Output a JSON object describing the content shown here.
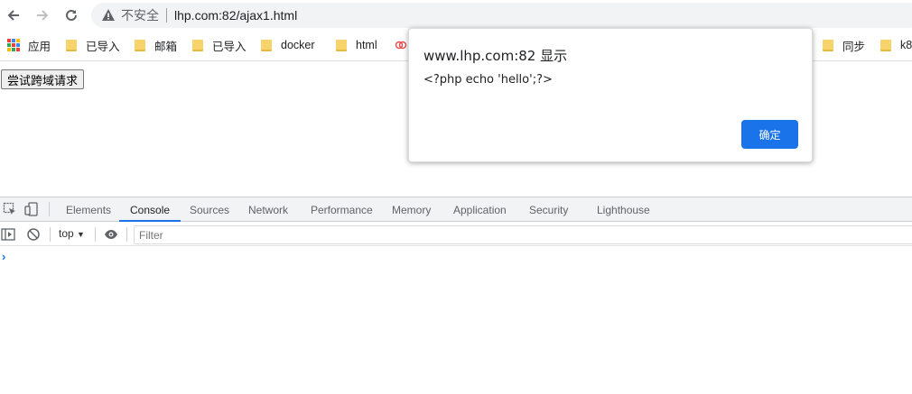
{
  "browser": {
    "insecure_label": "不安全",
    "url": "lhp.com:82/ajax1.html"
  },
  "bookmarks": [
    {
      "label": "应用",
      "icon": "apps-grid-icon"
    },
    {
      "label": "已导入",
      "icon": "folder-icon"
    },
    {
      "label": "邮箱",
      "icon": "folder-icon"
    },
    {
      "label": "已导入",
      "icon": "folder-icon"
    },
    {
      "label": "docker",
      "icon": "folder-icon"
    },
    {
      "label": "html",
      "icon": "folder-icon"
    },
    {
      "label": "同步",
      "icon": "folder-icon"
    },
    {
      "label": "k8",
      "icon": "folder-icon"
    }
  ],
  "page": {
    "button_label": "尝试跨域请求"
  },
  "dialog": {
    "title": "www.lhp.com:82 显示",
    "message": "<?php echo 'hello';?>",
    "ok_label": "确定"
  },
  "devtools": {
    "tabs": [
      "Elements",
      "Console",
      "Sources",
      "Network",
      "Performance",
      "Memory",
      "Application",
      "Security",
      "Lighthouse"
    ],
    "active_tab": "Console",
    "context": "top",
    "filter_placeholder": "Filter",
    "prompt": "›"
  },
  "colors": {
    "accent": "#1a73e8",
    "folder": "#f7d36b"
  }
}
